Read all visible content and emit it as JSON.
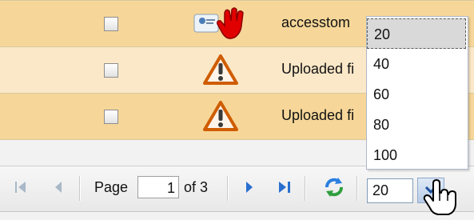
{
  "rows": [
    {
      "message": "accesstom",
      "icon": "hand-stop-icon"
    },
    {
      "message": "Uploaded fi",
      "icon": "warning-icon"
    },
    {
      "message": "Uploaded fi",
      "icon": "warning-icon"
    }
  ],
  "toolbar": {
    "page_label": "Page",
    "page_value": "1",
    "of_label": "of 3",
    "page_size": "20"
  },
  "dropdown": {
    "options": [
      "20",
      "40",
      "60",
      "80",
      "100"
    ]
  },
  "colors": {
    "row_sel": "#f6d799",
    "row_alt": "#fbe8c8",
    "nav_blue": "#2a6fd0"
  }
}
